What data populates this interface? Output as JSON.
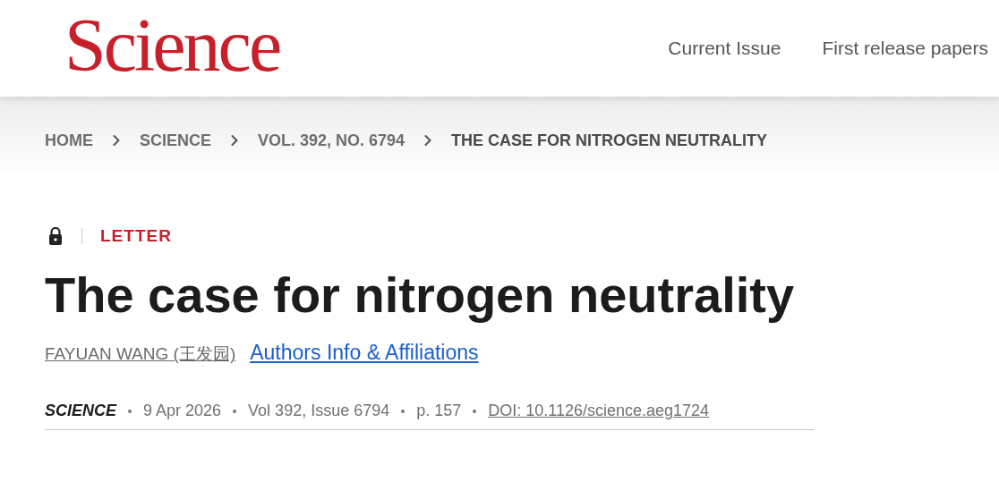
{
  "header": {
    "logo": "Science",
    "nav": [
      {
        "label": "Current Issue"
      },
      {
        "label": "First release papers"
      }
    ]
  },
  "breadcrumbs": [
    {
      "label": "HOME",
      "current": false
    },
    {
      "label": "SCIENCE",
      "current": false
    },
    {
      "label": "VOL. 392, NO. 6794",
      "current": false
    },
    {
      "label": "THE CASE FOR NITROGEN NEUTRALITY",
      "current": true
    }
  ],
  "article": {
    "locked": true,
    "type": "LETTER",
    "title": "The case for nitrogen neutrality",
    "authors": [
      {
        "name": "FAYUAN WANG (王发园)"
      }
    ],
    "affiliations_link": "Authors Info & Affiliations",
    "meta": [
      {
        "kind": "journal",
        "text": "SCIENCE"
      },
      {
        "kind": "text",
        "text": "9 Apr 2026"
      },
      {
        "kind": "text",
        "text": "Vol 392, Issue 6794"
      },
      {
        "kind": "text",
        "text": "p. 157"
      },
      {
        "kind": "link",
        "text": "DOI: 10.1126/science.aeg1724"
      }
    ]
  }
}
